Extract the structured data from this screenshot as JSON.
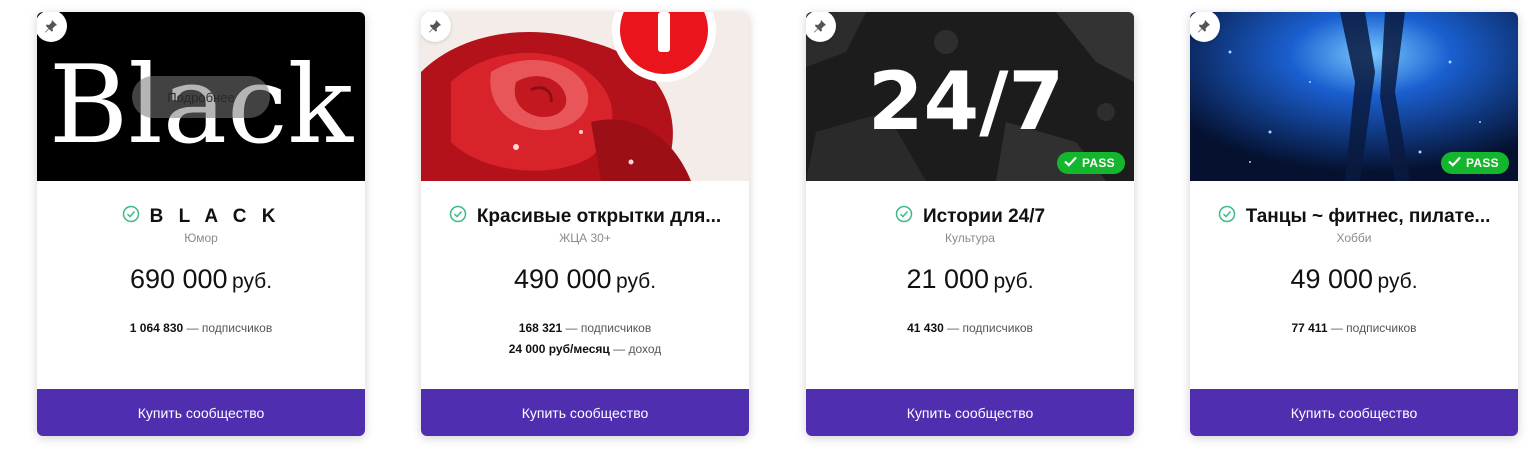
{
  "colors": {
    "accent": "#4f2eb0",
    "pass_badge": "#13b62c",
    "verified": "#3dbb83"
  },
  "cards": [
    {
      "cover_text": "Black",
      "more_label": "Подробнее",
      "title": "B L A C K",
      "category": "Юмор",
      "price": "690 000",
      "currency": "руб.",
      "stats": [
        {
          "value": "1 064 830",
          "label": "— подписчиков"
        }
      ],
      "pass": false,
      "buy_label": "Купить сообщество"
    },
    {
      "title": "Красивые открытки для...",
      "category": "ЖЦА 30+",
      "price": "490 000",
      "currency": "руб.",
      "stats": [
        {
          "value": "168 321",
          "label": "— подписчиков"
        },
        {
          "value": "24 000 руб/месяц",
          "label": "— доход"
        }
      ],
      "pass": false,
      "buy_label": "Купить сообщество"
    },
    {
      "cover_text": "24/7",
      "title": "Истории 24/7",
      "category": "Культура",
      "price": "21 000",
      "currency": "руб.",
      "stats": [
        {
          "value": "41 430",
          "label": "— подписчиков"
        }
      ],
      "pass": true,
      "pass_label": "PASS",
      "buy_label": "Купить сообщество"
    },
    {
      "title": "Танцы ~ фитнес, пилате...",
      "category": "Хобби",
      "price": "49 000",
      "currency": "руб.",
      "stats": [
        {
          "value": "77 411",
          "label": "— подписчиков"
        }
      ],
      "pass": true,
      "pass_label": "PASS",
      "buy_label": "Купить сообщество"
    }
  ]
}
